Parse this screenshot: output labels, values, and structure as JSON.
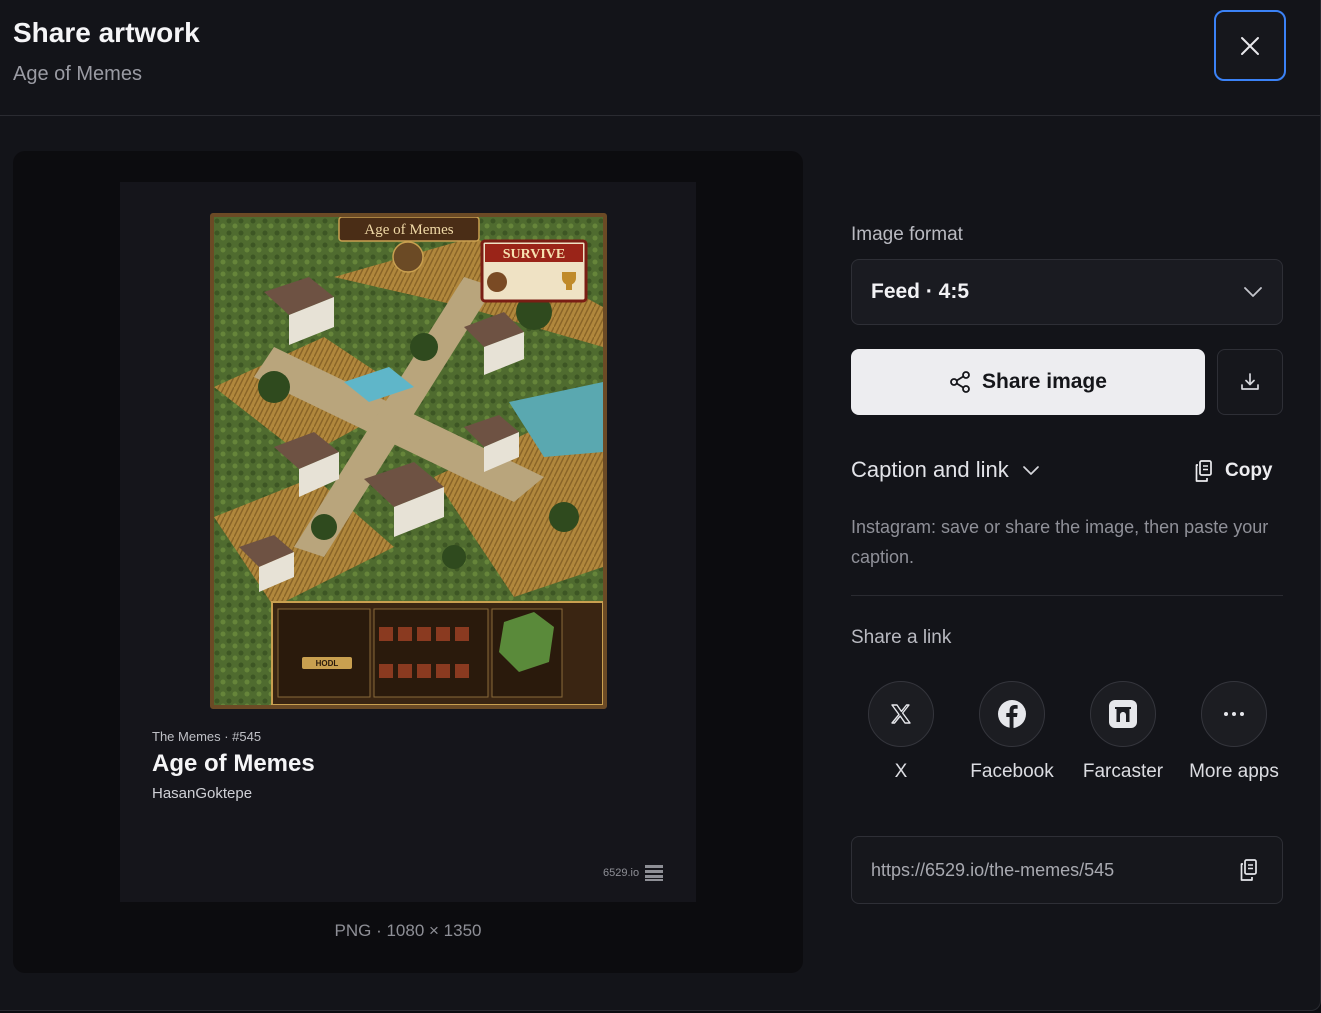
{
  "header": {
    "title": "Share artwork",
    "subtitle": "Age of Memes"
  },
  "preview": {
    "art_title_banner": "Age of Memes",
    "art_popup_title": "SURVIVE",
    "art_panel_button": "HODL",
    "collection_line": "The Memes · #545",
    "title": "Age of Memes",
    "artist": "HasanGoktepe",
    "watermark": "6529.io",
    "file_info": "PNG · 1080 × 1350"
  },
  "format": {
    "label": "Image format",
    "selected": "Feed · 4:5"
  },
  "actions": {
    "share_label": "Share image"
  },
  "caption": {
    "toggle_label": "Caption and link",
    "copy_label": "Copy",
    "hint": "Instagram: save or share the image, then paste your caption."
  },
  "share_link": {
    "label": "Share a link",
    "services": [
      {
        "label": "X",
        "icon": "x-logo-icon"
      },
      {
        "label": "Facebook",
        "icon": "facebook-logo-icon"
      },
      {
        "label": "Farcaster",
        "icon": "farcaster-logo-icon"
      },
      {
        "label": "More apps",
        "icon": "more-dots-icon"
      }
    ],
    "url": "https://6529.io/the-memes/545"
  }
}
